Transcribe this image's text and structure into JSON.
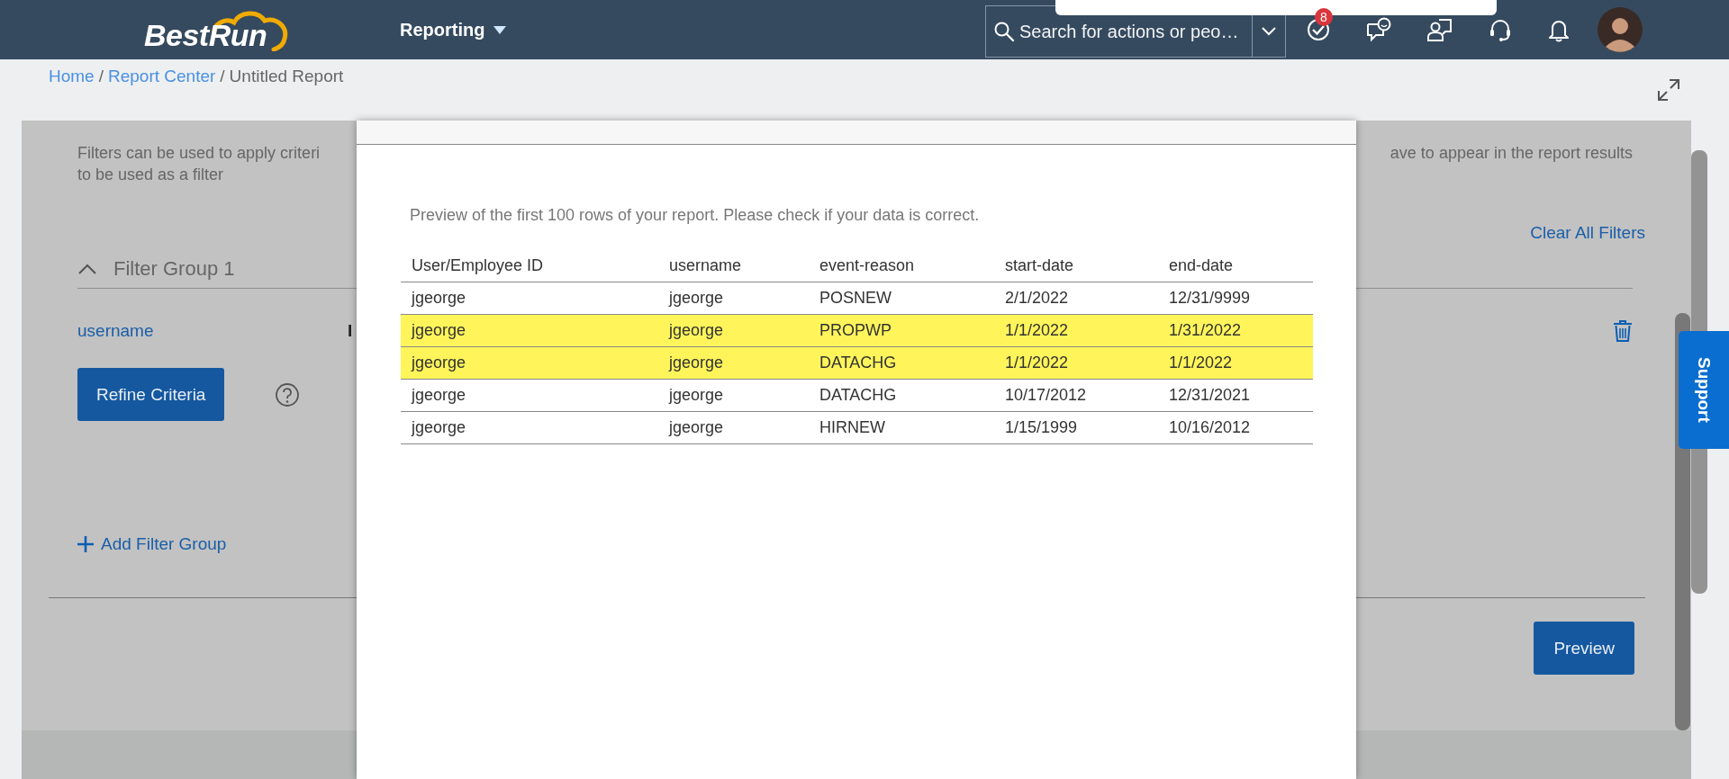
{
  "header": {
    "logo": "BestRun",
    "module_menu": "Reporting",
    "search": {
      "placeholder": "Search for actions or peo…"
    },
    "notification_badge": "8"
  },
  "breadcrumb": [
    {
      "label": "Home",
      "link": true
    },
    {
      "separator": "/",
      "label": "Report Center",
      "link": true
    },
    {
      "separator": "/",
      "label": "Untitled Report",
      "link": false
    }
  ],
  "filters_panel": {
    "description_left": [
      "Filters can be used to apply criteri",
      "to be used as a filter"
    ],
    "description_right": "ave to appear in the report results",
    "clear_all": "Clear All Filters",
    "groups": [
      {
        "title": "Filter Group 1",
        "expanded": true,
        "field": "username",
        "operator": "I",
        "refine_button": "Refine Criteria"
      }
    ],
    "add_group": "Add Filter Group",
    "preview_button": "Preview"
  },
  "preview_dialog": {
    "message": "Preview of the first 100 rows of your report. Please check if your data is correct.",
    "table": {
      "columns": [
        "User/Employee ID",
        "username",
        "event-reason",
        "start-date",
        "end-date"
      ],
      "rows": [
        {
          "cells": [
            "jgeorge",
            "jgeorge",
            "POSNEW",
            "2/1/2022",
            "12/31/9999"
          ],
          "highlighted": false
        },
        {
          "cells": [
            "jgeorge",
            "jgeorge",
            "PROPWP",
            "1/1/2022",
            "1/31/2022"
          ],
          "highlighted": true
        },
        {
          "cells": [
            "jgeorge",
            "jgeorge",
            "DATACHG",
            "1/1/2022",
            "1/1/2022"
          ],
          "highlighted": true
        },
        {
          "cells": [
            "jgeorge",
            "jgeorge",
            "DATACHG",
            "10/17/2012",
            "12/31/2021"
          ],
          "highlighted": false
        },
        {
          "cells": [
            "jgeorge",
            "jgeorge",
            "HIRNEW",
            "1/15/1999",
            "10/16/2012"
          ],
          "highlighted": false
        }
      ]
    }
  },
  "support_tab": "Support"
}
